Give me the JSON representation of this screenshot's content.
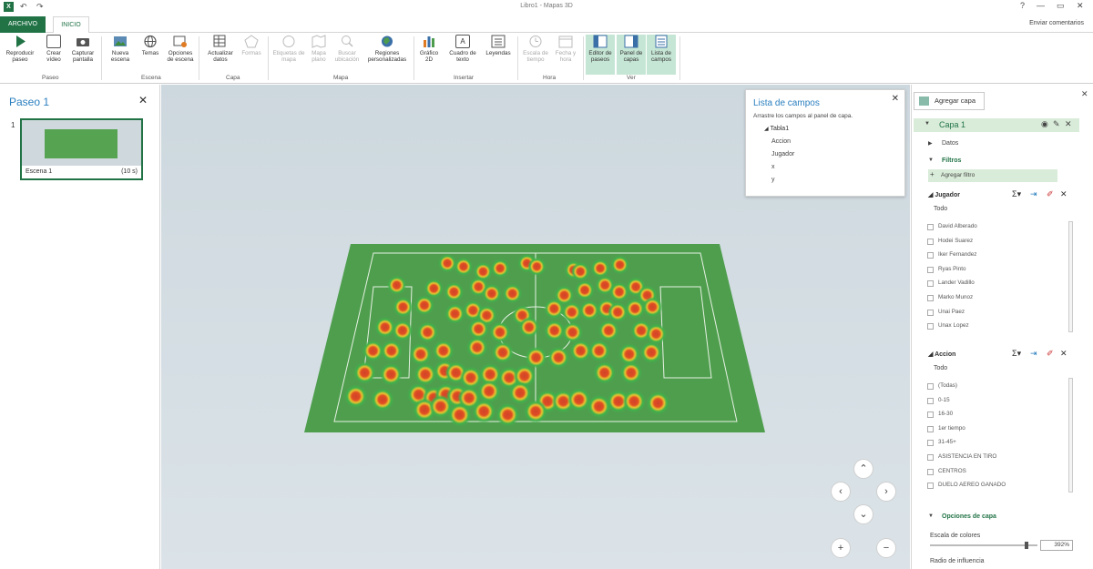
{
  "window": {
    "title": "Libro1 - Mapas 3D",
    "send_feedback": "Enviar comentarios"
  },
  "tabs": {
    "file": "ARCHIVO",
    "home": "INICIO"
  },
  "ribbon": {
    "groups": {
      "tour": "Paseo",
      "scene": "Escena",
      "layer": "Capa",
      "map": "Mapa",
      "insert": "Insertar",
      "time": "Hora",
      "view": "Ver"
    },
    "buttons": {
      "play_tour": "Reproducir paseo",
      "create_video": "Crear vídeo",
      "capture_screen": "Capturar pantalla",
      "new_scene": "Nueva escena",
      "themes": "Temas",
      "scene_options": "Opciones de escena",
      "refresh_data": "Actualizar datos",
      "shapes": "Formas",
      "map_labels": "Etiquetas de mapa",
      "flat_map": "Mapa plano",
      "find_location": "Buscar ubicación",
      "custom_regions": "Regiones personalizadas",
      "chart_2d": "Gráfico 2D",
      "text_box": "Cuadro de texto",
      "legends": "Leyendas",
      "timeline": "Escala de tiempo",
      "date_time": "Fecha y hora",
      "tour_editor": "Editor de paseos",
      "layer_pane": "Panel de capas",
      "field_list": "Lista de campos"
    }
  },
  "left_pane": {
    "title": "Paseo 1",
    "scene_number": "1",
    "scene_name": "Escena 1",
    "scene_duration": "(10 s)"
  },
  "field_list": {
    "title": "Lista de campos",
    "hint": "Arrastre los campos al panel de capa.",
    "table": "Tabla1",
    "fields": [
      "Accion",
      "Jugador",
      "x",
      "y"
    ]
  },
  "layer_pane": {
    "add_layer": "Agregar capa",
    "layer_name": "Capa 1",
    "data": "Datos",
    "filters": "Filtros",
    "add_filter": "Agregar filtro",
    "player_filter": {
      "title": "Jugador",
      "all": "Todo",
      "options": [
        "David Alberado",
        "Hodei Suarez",
        "Iker Fernandez",
        "Ryas Pinto",
        "Lander Vadillo",
        "Marko Munoz",
        "Unai Paez",
        "Unax Lopez"
      ]
    },
    "action_filter": {
      "title": "Accion",
      "all": "Todo",
      "options": [
        "(Todas)",
        "0-15",
        "16-30",
        "1er tiempo",
        "31-45+",
        "ASISTENCIA EN TIRO",
        "CENTROS",
        "DUELO AEREO GANADO"
      ]
    },
    "layer_options": "Opciones de capa",
    "color_scale": "Escala de colores",
    "color_scale_value": "392%",
    "color_scale_level": 0.9,
    "influence_radius": "Radio de influencia"
  },
  "heat_points": [
    [
      0.23,
      0.06
    ],
    [
      0.28,
      0.08
    ],
    [
      0.34,
      0.11
    ],
    [
      0.39,
      0.09
    ],
    [
      0.47,
      0.06
    ],
    [
      0.5,
      0.08
    ],
    [
      0.61,
      0.1
    ],
    [
      0.63,
      0.11
    ],
    [
      0.69,
      0.09
    ],
    [
      0.75,
      0.07
    ],
    [
      0.09,
      0.19
    ],
    [
      0.2,
      0.21
    ],
    [
      0.26,
      0.23
    ],
    [
      0.33,
      0.2
    ],
    [
      0.37,
      0.24
    ],
    [
      0.43,
      0.24
    ],
    [
      0.58,
      0.25
    ],
    [
      0.64,
      0.22
    ],
    [
      0.7,
      0.19
    ],
    [
      0.74,
      0.23
    ],
    [
      0.79,
      0.2
    ],
    [
      0.82,
      0.25
    ],
    [
      0.12,
      0.32
    ],
    [
      0.18,
      0.31
    ],
    [
      0.27,
      0.36
    ],
    [
      0.32,
      0.34
    ],
    [
      0.36,
      0.37
    ],
    [
      0.46,
      0.37
    ],
    [
      0.55,
      0.33
    ],
    [
      0.6,
      0.35
    ],
    [
      0.65,
      0.34
    ],
    [
      0.7,
      0.33
    ],
    [
      0.73,
      0.35
    ],
    [
      0.78,
      0.33
    ],
    [
      0.83,
      0.32
    ],
    [
      0.08,
      0.44
    ],
    [
      0.13,
      0.46
    ],
    [
      0.2,
      0.47
    ],
    [
      0.34,
      0.45
    ],
    [
      0.4,
      0.47
    ],
    [
      0.48,
      0.44
    ],
    [
      0.55,
      0.46
    ],
    [
      0.6,
      0.47
    ],
    [
      0.7,
      0.46
    ],
    [
      0.79,
      0.46
    ],
    [
      0.83,
      0.48
    ],
    [
      0.06,
      0.58
    ],
    [
      0.11,
      0.58
    ],
    [
      0.19,
      0.6
    ],
    [
      0.25,
      0.58
    ],
    [
      0.34,
      0.56
    ],
    [
      0.41,
      0.59
    ],
    [
      0.5,
      0.62
    ],
    [
      0.56,
      0.62
    ],
    [
      0.62,
      0.58
    ],
    [
      0.67,
      0.58
    ],
    [
      0.75,
      0.6
    ],
    [
      0.81,
      0.59
    ],
    [
      0.05,
      0.71
    ],
    [
      0.12,
      0.72
    ],
    [
      0.21,
      0.72
    ],
    [
      0.26,
      0.7
    ],
    [
      0.29,
      0.71
    ],
    [
      0.33,
      0.74
    ],
    [
      0.38,
      0.72
    ],
    [
      0.43,
      0.74
    ],
    [
      0.47,
      0.73
    ],
    [
      0.68,
      0.71
    ],
    [
      0.75,
      0.71
    ],
    [
      0.04,
      0.85
    ],
    [
      0.11,
      0.87
    ],
    [
      0.2,
      0.84
    ],
    [
      0.24,
      0.86
    ],
    [
      0.27,
      0.84
    ],
    [
      0.3,
      0.85
    ],
    [
      0.33,
      0.86
    ],
    [
      0.38,
      0.82
    ],
    [
      0.46,
      0.83
    ],
    [
      0.53,
      0.88
    ],
    [
      0.57,
      0.88
    ],
    [
      0.61,
      0.87
    ],
    [
      0.22,
      0.93
    ],
    [
      0.26,
      0.91
    ],
    [
      0.31,
      0.96
    ],
    [
      0.37,
      0.94
    ],
    [
      0.43,
      0.96
    ],
    [
      0.5,
      0.94
    ],
    [
      0.66,
      0.91
    ],
    [
      0.71,
      0.88
    ],
    [
      0.75,
      0.88
    ],
    [
      0.81,
      0.89
    ]
  ]
}
